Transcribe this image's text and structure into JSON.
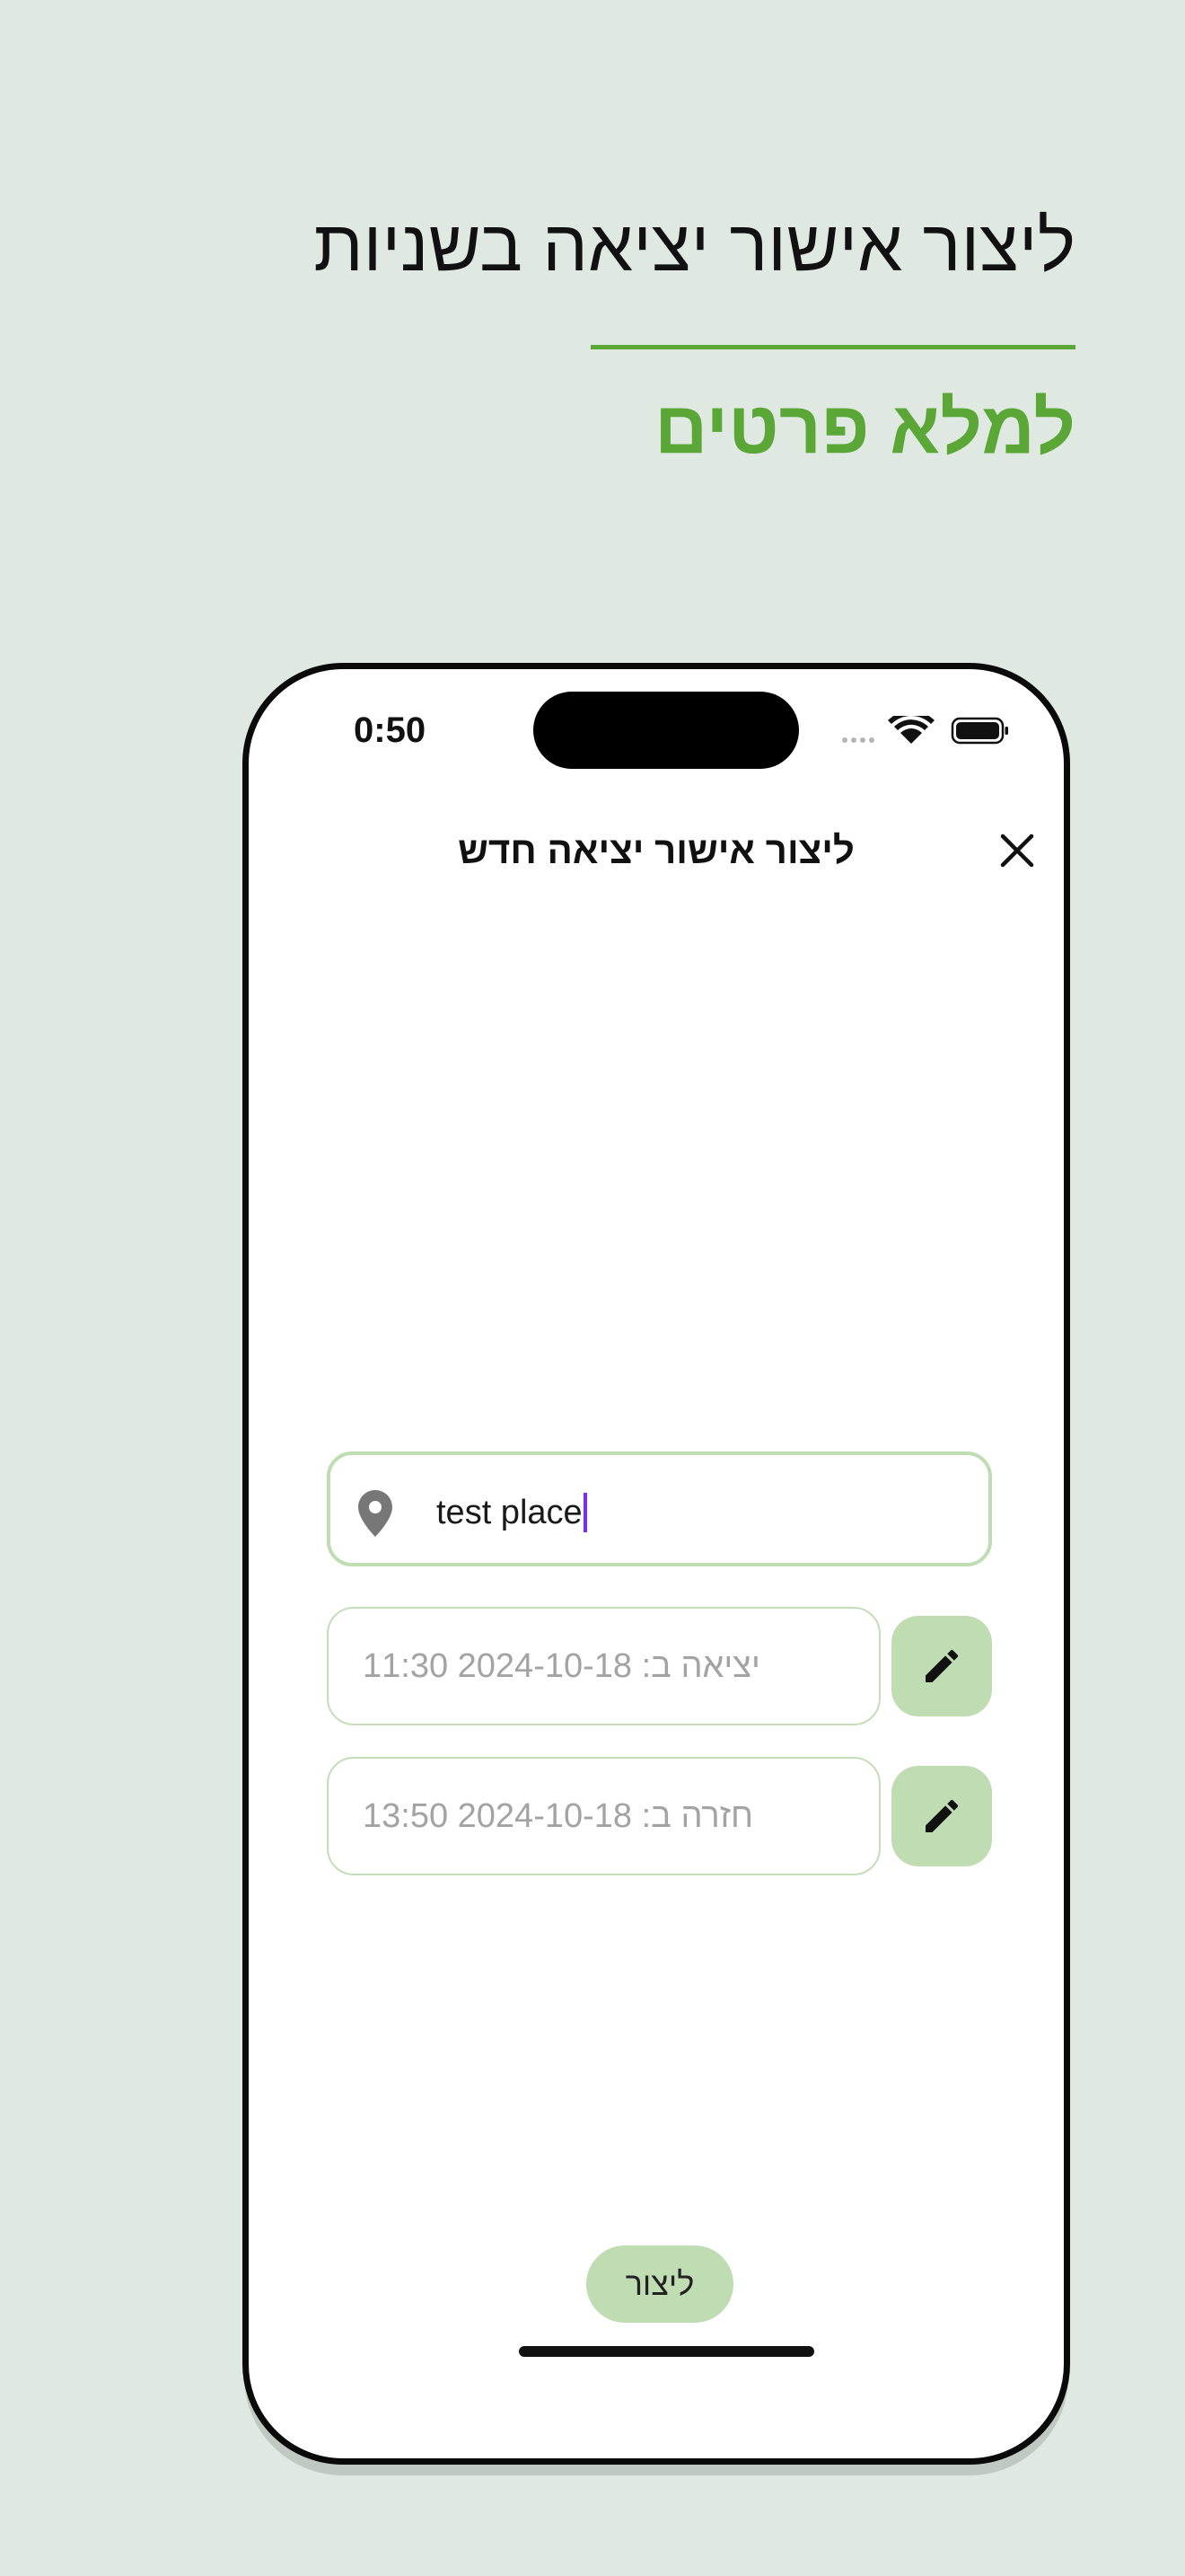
{
  "banner": {
    "headline": "ליצור אישור יציאה בשניות",
    "subheadline": "למלא פרטים"
  },
  "status_bar": {
    "time": "0:50",
    "icons": [
      "signal-dots-icon",
      "wifi-icon",
      "battery-icon"
    ]
  },
  "dialog": {
    "title": "ליצור אישור יציאה חדש",
    "close_icon": "close-icon"
  },
  "form": {
    "place": {
      "icon": "location-pin-icon",
      "value": "test place"
    },
    "departure": {
      "text": "יציאה ב: 2024-10-18 11:30",
      "edit_icon": "pencil-icon"
    },
    "return": {
      "text": "חזרה ב: 2024-10-18 13:50",
      "edit_icon": "pencil-icon"
    },
    "submit_label": "ליצור"
  },
  "colors": {
    "background": "#dfe9e1",
    "accent_green": "#5aa637",
    "light_green": "#bfdcb3",
    "caret": "#7b2cf2"
  }
}
